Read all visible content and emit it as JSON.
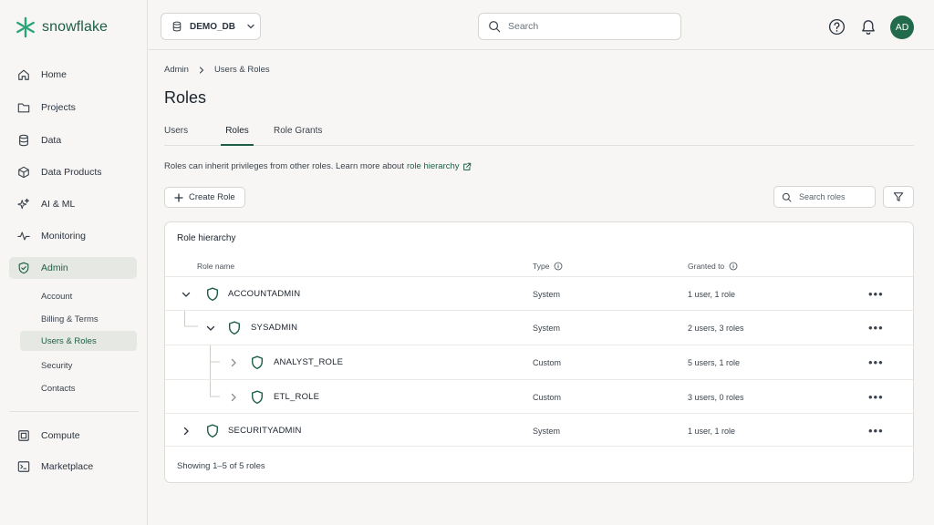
{
  "brand": {
    "name": "snowflake",
    "color": "#29a37a"
  },
  "sidebar": {
    "nav": [
      {
        "label": "Home",
        "icon": "home-icon"
      },
      {
        "label": "Projects",
        "icon": "folder-icon"
      },
      {
        "label": "Data",
        "icon": "database-icon"
      },
      {
        "label": "Data Products",
        "icon": "cube-icon"
      },
      {
        "label": "AI & ML",
        "icon": "sparkle-icon"
      },
      {
        "label": "Monitoring",
        "icon": "activity-icon"
      },
      {
        "label": "Admin",
        "icon": "shield-icon",
        "active": true
      }
    ],
    "admin_sub": [
      {
        "label": "Account"
      },
      {
        "label": "Billing & Terms"
      },
      {
        "label": "Users & Roles",
        "active": true
      },
      {
        "label": "Security"
      },
      {
        "label": "Contacts"
      }
    ],
    "bottom": [
      {
        "label": "Compute",
        "icon": "compute-icon"
      },
      {
        "label": "Marketplace",
        "icon": "terminal-icon"
      }
    ]
  },
  "topbar": {
    "database": "DEMO_DB",
    "search_placeholder": "Search",
    "avatar_initials": "AD"
  },
  "breadcrumb": [
    "Admin",
    "Users & Roles"
  ],
  "page_title": "Roles",
  "tabs": [
    {
      "label": "Users"
    },
    {
      "label": "Roles",
      "active": true
    },
    {
      "label": "Role Grants"
    }
  ],
  "description": {
    "text": "Roles can inherit privileges from other roles. Learn more about",
    "link": "role hierarchy"
  },
  "actions": {
    "create_label": "Create Role",
    "search_placeholder": "Search roles"
  },
  "table": {
    "title": "Role hierarchy",
    "columns": [
      "Role name",
      "Type",
      "Granted to"
    ],
    "rows": [
      {
        "name": "ACCOUNTADMIN",
        "type": "System",
        "granted": "1 user, 1 role",
        "expanded": true,
        "depth": 0
      },
      {
        "name": "SYSADMIN",
        "type": "System",
        "granted": "2 users, 3 roles",
        "expanded": true,
        "depth": 1
      },
      {
        "name": "ANALYST_ROLE",
        "type": "Custom",
        "granted": "5 users, 1 role",
        "expanded": false,
        "depth": 2
      },
      {
        "name": "ETL_ROLE",
        "type": "Custom",
        "granted": "3 users, 0 roles",
        "expanded": false,
        "depth": 2
      },
      {
        "name": "SECURITYADMIN",
        "type": "System",
        "granted": "1 user, 1 role",
        "expanded": false,
        "depth": 0
      }
    ],
    "footer": "Showing 1–5 of 5 roles"
  },
  "colors": {
    "accent": "#1e5e46",
    "avatar_bg": "#226a4c"
  }
}
